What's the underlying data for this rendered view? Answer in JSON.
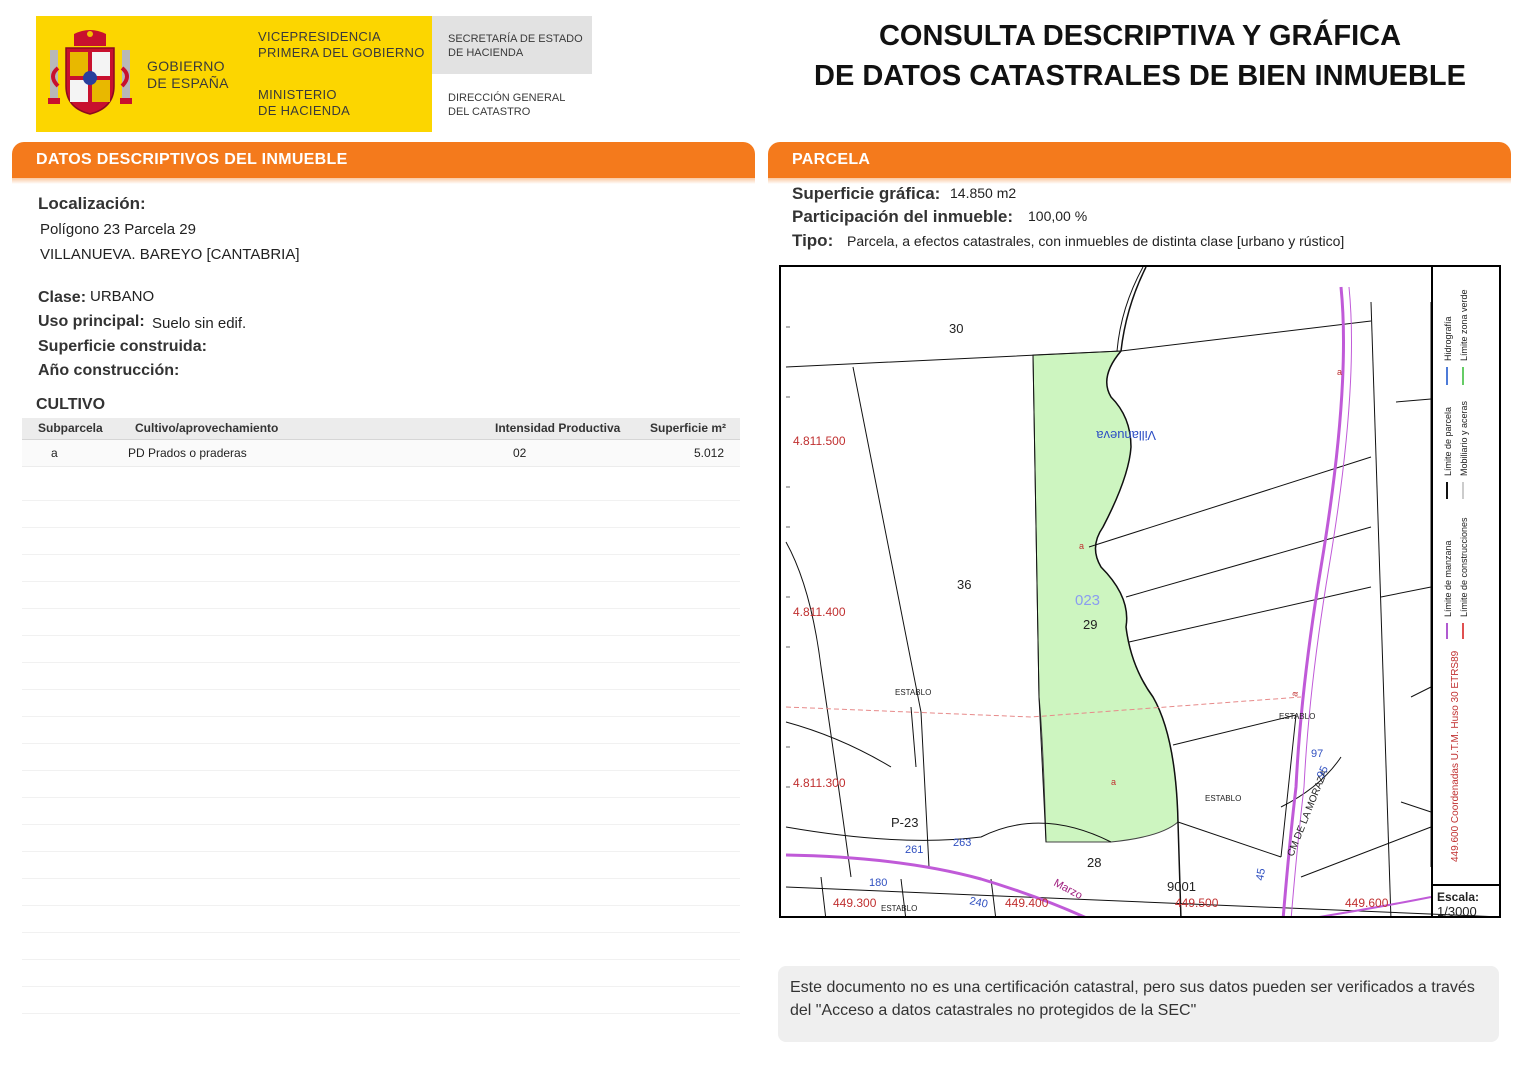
{
  "header": {
    "gov_name": "GOBIERNO\nDE ESPAÑA",
    "vicepresidencia": "VICEPRESIDENCIA\nPRIMERA DEL GOBIERNO",
    "ministerio": "MINISTERIO\nDE HACIENDA",
    "secretaria": "SECRETARÍA DE ESTADO\nDE HACIENDA",
    "direccion": "DIRECCIÓN GENERAL\nDEL CATASTRO",
    "title_line1": "CONSULTA DESCRIPTIVA Y GRÁFICA",
    "title_line2": "DE DATOS CATASTRALES DE BIEN INMUEBLE",
    "brand_yellow": "#fcd600",
    "accent_orange": "#f47a1c"
  },
  "left": {
    "section_title": "DATOS DESCRIPTIVOS DEL INMUEBLE",
    "localizacion_label": "Localización:",
    "localizacion_line1": "Polígono 23 Parcela 29",
    "localizacion_line2": "VILLANUEVA. BAREYO [CANTABRIA]",
    "clase_label": "Clase:",
    "clase_value": "URBANO",
    "uso_label": "Uso principal:",
    "uso_value": "Suelo sin edif.",
    "superficie_label": "Superficie construida:",
    "anio_label": "Año construcción:",
    "cultivo_title": "CULTIVO",
    "table": {
      "headers": [
        "Subparcela",
        "Cultivo/aprovechamiento",
        "Intensidad Productiva",
        "Superficie m²"
      ],
      "rows": [
        [
          "a",
          "PD Prados o praderas",
          "02",
          "5.012"
        ]
      ]
    }
  },
  "right": {
    "section_title": "PARCELA",
    "superficie_grafica_label": "Superficie gráfica:",
    "superficie_grafica_value": "14.850 m2",
    "participacion_label": "Participación del inmueble:",
    "participacion_value": "100,00 %",
    "tipo_label": "Tipo:",
    "tipo_value": "Parcela, a efectos catastrales, con inmuebles de distinta clase [urbano y rústico]",
    "map": {
      "parcel_labels": [
        "30",
        "36",
        "29",
        "28",
        "97",
        "9001"
      ],
      "poligono_label": "023",
      "poligono_ref": "P-23",
      "river_label": "Villanueva",
      "road_label": "CM DE LA MORAZA",
      "road_label_2": "Marzo",
      "road_number": "95",
      "building_labels": [
        "ESTABLO",
        "ESTABLO",
        "ESTABLO",
        "ESTABLO"
      ],
      "subparcel_marks": [
        "a",
        "a",
        "a",
        "a"
      ],
      "blue_numbers": [
        "261",
        "263",
        "180",
        "240",
        "45"
      ],
      "y_coords": [
        "4.811.500",
        "4.811.400",
        "4.811.300"
      ],
      "x_coords": [
        "449.300",
        "449.400",
        "449.500",
        "449.600"
      ],
      "coord_note": "449.600 Coordenadas U.T.M. Huso 30 ETRS89",
      "legend": [
        "Límite de manzana",
        "Límite de construcciones",
        "Límite de parcela",
        "Mobiliario y aceras",
        "Hidrografía",
        "Límite zona verde"
      ],
      "escala_label": "Escala:",
      "escala_value": "1/3000",
      "parcel_fill": "#cdf5c0"
    },
    "note": "Este documento no es una certificación catastral, pero sus datos pueden ser verificados a través del \"Acceso a datos catastrales no protegidos de la SEC\""
  }
}
